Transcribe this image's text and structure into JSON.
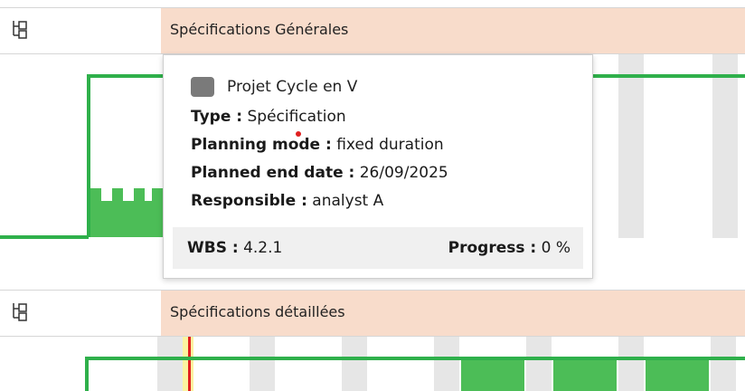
{
  "rows": [
    {
      "title": "Spécifications Générales"
    },
    {
      "title": "Spécifications détaillées"
    }
  ],
  "tooltip": {
    "project": "Projet Cycle en V",
    "type_label": "Type :",
    "type_value": "Spécification",
    "planning_label": "Planning mode :",
    "planning_value": "fixed duration",
    "end_label": "Planned end date :",
    "end_value": "26/09/2025",
    "responsible_label": "Responsible :",
    "responsible_value": "analyst A",
    "wbs_label": "WBS :",
    "wbs_value": "4.2.1",
    "progress_label": "Progress :",
    "progress_value": "0 %"
  },
  "colors": {
    "task_green": "#2fb04b",
    "header_band": "#f8dccb",
    "today_marker": "#e02020",
    "project_square": "#7a7a7a"
  },
  "icons": [
    "wbs-tree-icon"
  ]
}
